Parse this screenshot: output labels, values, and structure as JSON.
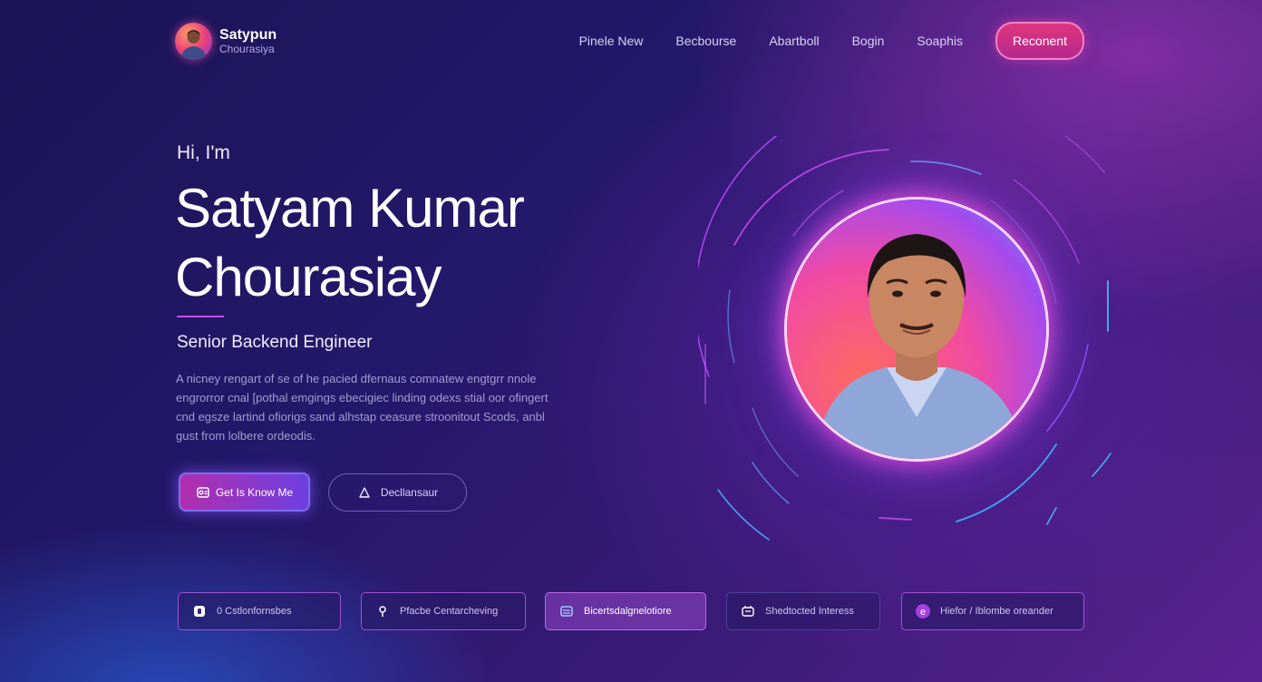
{
  "header": {
    "logo_name": "Satypun",
    "logo_sub": "Chourasiya",
    "nav": [
      "Pinele New",
      "Becbourse",
      "Abartboll",
      "Bogin",
      "Soaphis"
    ],
    "cta": "Reconent"
  },
  "hero": {
    "greeting": "Hi, I'm",
    "name_line1": "Satyam Kumar",
    "name_line2": "Chourasiay",
    "role": "Senior Backend Engineer",
    "bio": "A nicney rengart of se of he pacied dfernaus comnatew engtgrr nnole engrorror cnal [pothal emgings ebecigiec linding odexs stial oor ofingert cnd egsze lartind ofiorigs sand alhstap ceasure stroonitout Scods, anbl gust from lolbere ordeodis.",
    "btn_primary": "Get Is Know Me",
    "btn_secondary": "Decllansaur"
  },
  "cards": [
    {
      "label": "0 Cstlonfornsbes",
      "icon": "square-icon"
    },
    {
      "label": "Pfacbe Centarcheving",
      "icon": "pin-icon"
    },
    {
      "label": "Bicertsdalgnelotiore",
      "icon": "layers-icon"
    },
    {
      "label": "Shedtocted Interess",
      "icon": "network-icon"
    },
    {
      "label": "Hiefor / Iblombe oreander",
      "icon": "circle-e-icon"
    }
  ],
  "colors": {
    "accent": "#c44ee8",
    "cta": "#e0357c",
    "background": "#211763"
  }
}
